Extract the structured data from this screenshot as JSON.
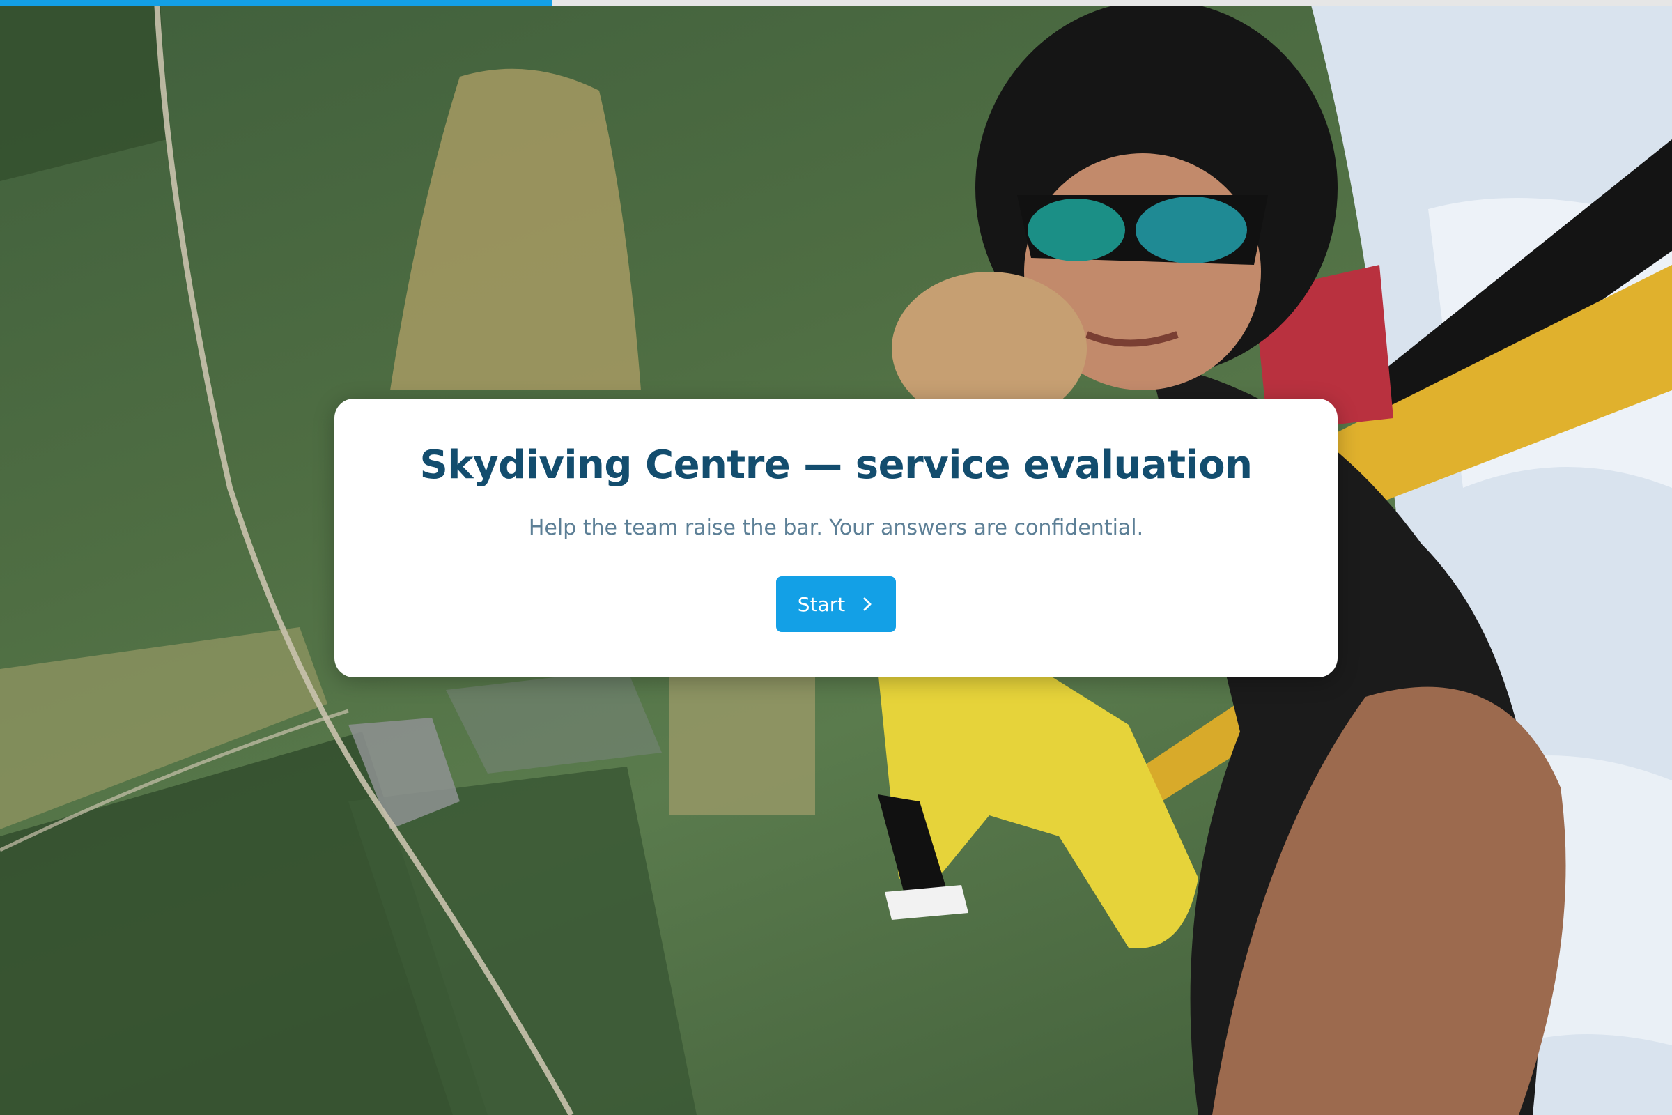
{
  "progress": {
    "fraction": 0.33,
    "fill_color": "#13a0e6",
    "track_color": "#e6e6e6"
  },
  "background": {
    "image": "tandem-skydive-photo",
    "accent_colors": {
      "forest": "#3f5b38",
      "sky": "#d9e3ee",
      "strap": "#e0b12d",
      "suit": "#e6d33a"
    }
  },
  "survey": {
    "title": "Skydiving Centre — service evaluation",
    "subtitle": "Help the team raise the bar. Your answers are confidential.",
    "start_button": {
      "label": "Start",
      "icon": "chevron-right-icon",
      "color": "#13a0e6"
    }
  }
}
